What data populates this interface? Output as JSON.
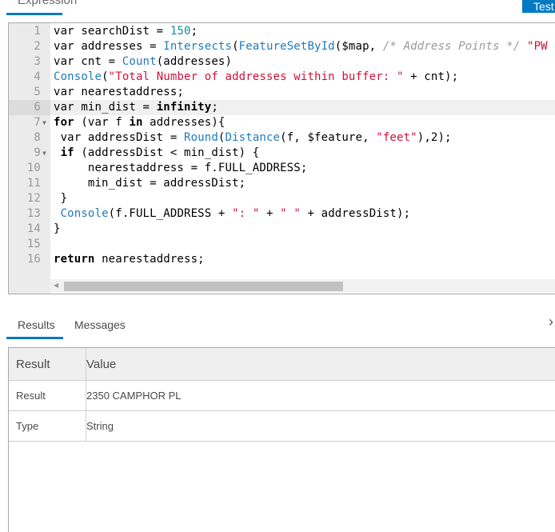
{
  "header": {
    "tab_expression": "Expression",
    "test_button": "Test"
  },
  "editor": {
    "active_line": 6,
    "lines": [
      {
        "n": "1",
        "fold": false,
        "tokens": [
          [
            "p",
            "var searchDist = "
          ],
          [
            "num",
            "150"
          ],
          [
            "p",
            ";"
          ]
        ]
      },
      {
        "n": "2",
        "fold": false,
        "tokens": [
          [
            "p",
            "var addresses = "
          ],
          [
            "fn",
            "Intersects"
          ],
          [
            "p",
            "("
          ],
          [
            "fn",
            "FeatureSetById"
          ],
          [
            "p",
            "($map, "
          ],
          [
            "cm",
            "/* Address Points */"
          ],
          [
            "p",
            " "
          ],
          [
            "str",
            "\"PW"
          ]
        ]
      },
      {
        "n": "3",
        "fold": false,
        "tokens": [
          [
            "p",
            "var cnt = "
          ],
          [
            "fn",
            "Count"
          ],
          [
            "p",
            "(addresses)"
          ]
        ]
      },
      {
        "n": "4",
        "fold": false,
        "tokens": [
          [
            "fn",
            "Console"
          ],
          [
            "p",
            "("
          ],
          [
            "str",
            "\"Total Number of addresses within buffer: \""
          ],
          [
            "p",
            " + cnt);"
          ]
        ]
      },
      {
        "n": "5",
        "fold": false,
        "tokens": [
          [
            "p",
            "var nearestaddress;"
          ]
        ]
      },
      {
        "n": "6",
        "fold": false,
        "tokens": [
          [
            "p",
            "var min_dist = "
          ],
          [
            "kw",
            "infinity"
          ],
          [
            "p",
            ";"
          ]
        ]
      },
      {
        "n": "7",
        "fold": true,
        "tokens": [
          [
            "kw",
            "for"
          ],
          [
            "p",
            " (var f "
          ],
          [
            "kw",
            "in"
          ],
          [
            "p",
            " addresses){"
          ]
        ]
      },
      {
        "n": "8",
        "fold": false,
        "tokens": [
          [
            "p",
            " var addressDist = "
          ],
          [
            "fn",
            "Round"
          ],
          [
            "p",
            "("
          ],
          [
            "fn",
            "Distance"
          ],
          [
            "p",
            "(f, $feature, "
          ],
          [
            "str",
            "\"feet\""
          ],
          [
            "p",
            "),2);"
          ]
        ]
      },
      {
        "n": "9",
        "fold": true,
        "tokens": [
          [
            "p",
            " "
          ],
          [
            "kw",
            "if"
          ],
          [
            "p",
            " (addressDist < min_dist) {"
          ]
        ]
      },
      {
        "n": "10",
        "fold": false,
        "tokens": [
          [
            "p",
            "     nearestaddress = f.FULL_ADDRESS;"
          ]
        ]
      },
      {
        "n": "11",
        "fold": false,
        "tokens": [
          [
            "p",
            "     min_dist = addressDist;"
          ]
        ]
      },
      {
        "n": "12",
        "fold": false,
        "tokens": [
          [
            "p",
            " }"
          ]
        ]
      },
      {
        "n": "13",
        "fold": false,
        "tokens": [
          [
            "p",
            " "
          ],
          [
            "fn",
            "Console"
          ],
          [
            "p",
            "(f.FULL_ADDRESS + "
          ],
          [
            "str",
            "\": \""
          ],
          [
            "p",
            " + "
          ],
          [
            "str",
            "\" \""
          ],
          [
            "p",
            " + addressDist);"
          ]
        ]
      },
      {
        "n": "14",
        "fold": false,
        "tokens": [
          [
            "p",
            "}"
          ]
        ]
      },
      {
        "n": "15",
        "fold": false,
        "tokens": []
      },
      {
        "n": "16",
        "fold": false,
        "tokens": [
          [
            "kw",
            "return"
          ],
          [
            "p",
            " nearestaddress;"
          ]
        ]
      }
    ]
  },
  "results": {
    "tabs": [
      "Results",
      "Messages"
    ],
    "table": {
      "headers": [
        "Result",
        "Value"
      ],
      "rows": [
        [
          "Result",
          "2350 CAMPHOR PL"
        ],
        [
          "Type",
          "String"
        ]
      ]
    }
  }
}
